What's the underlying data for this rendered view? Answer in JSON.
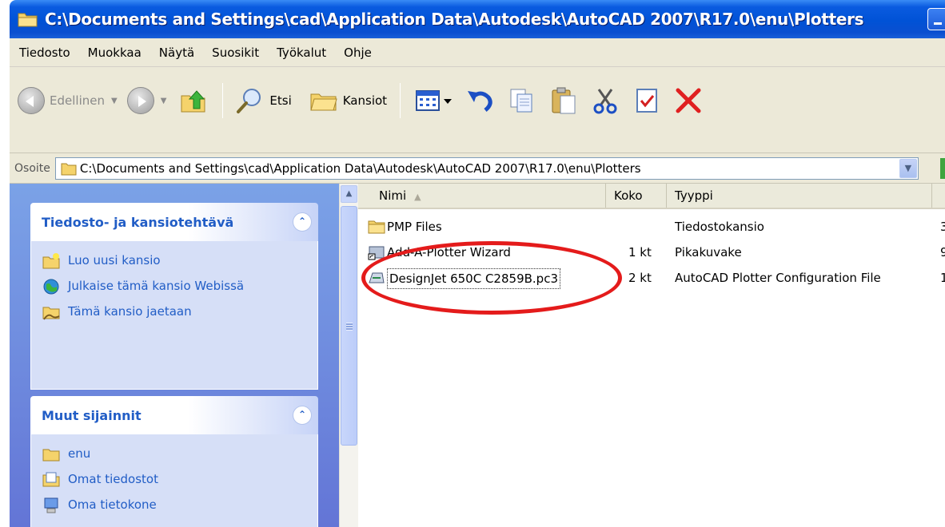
{
  "window": {
    "title": "C:\\Documents and Settings\\cad\\Application Data\\Autodesk\\AutoCAD 2007\\R17.0\\enu\\Plotters"
  },
  "menu": [
    "Tiedosto",
    "Muokkaa",
    "Näytä",
    "Suosikit",
    "Työkalut",
    "Ohje"
  ],
  "toolbar": {
    "back_label": "Edellinen",
    "search_label": "Etsi",
    "folders_label": "Kansiot"
  },
  "address": {
    "label": "Osoite",
    "value": "C:\\Documents and Settings\\cad\\Application Data\\Autodesk\\AutoCAD 2007\\R17.0\\enu\\Plotters"
  },
  "taskpane": {
    "file_tasks": {
      "title": "Tiedosto- ja kansiotehtävä",
      "items": [
        "Luo uusi kansio",
        "Julkaise tämä kansio Webissä",
        "Tämä kansio jaetaan"
      ]
    },
    "other_places": {
      "title": "Muut sijainnit",
      "items": [
        "enu",
        "Omat tiedostot",
        "Oma tietokone"
      ]
    }
  },
  "filelist": {
    "columns": [
      "Nimi",
      "Koko",
      "Tyyppi"
    ],
    "rows": [
      {
        "name": "PMP Files",
        "size": "",
        "type": "Tiedostokansio",
        "extra": "3",
        "icon": "folder-icon"
      },
      {
        "name": "Add-A-Plotter Wizard",
        "size": "1 kt",
        "type": "Pikakuvake",
        "extra": "9",
        "icon": "shortcut-icon"
      },
      {
        "name": "DesignJet 650C C2859B.pc3",
        "size": "2 kt",
        "type": "AutoCAD Plotter Configuration File",
        "extra": "1",
        "icon": "plotter-config-icon"
      }
    ]
  },
  "colors": {
    "title_bar": "#0052d6",
    "annotation": "#e41b1b",
    "task_link": "#215dc6"
  }
}
